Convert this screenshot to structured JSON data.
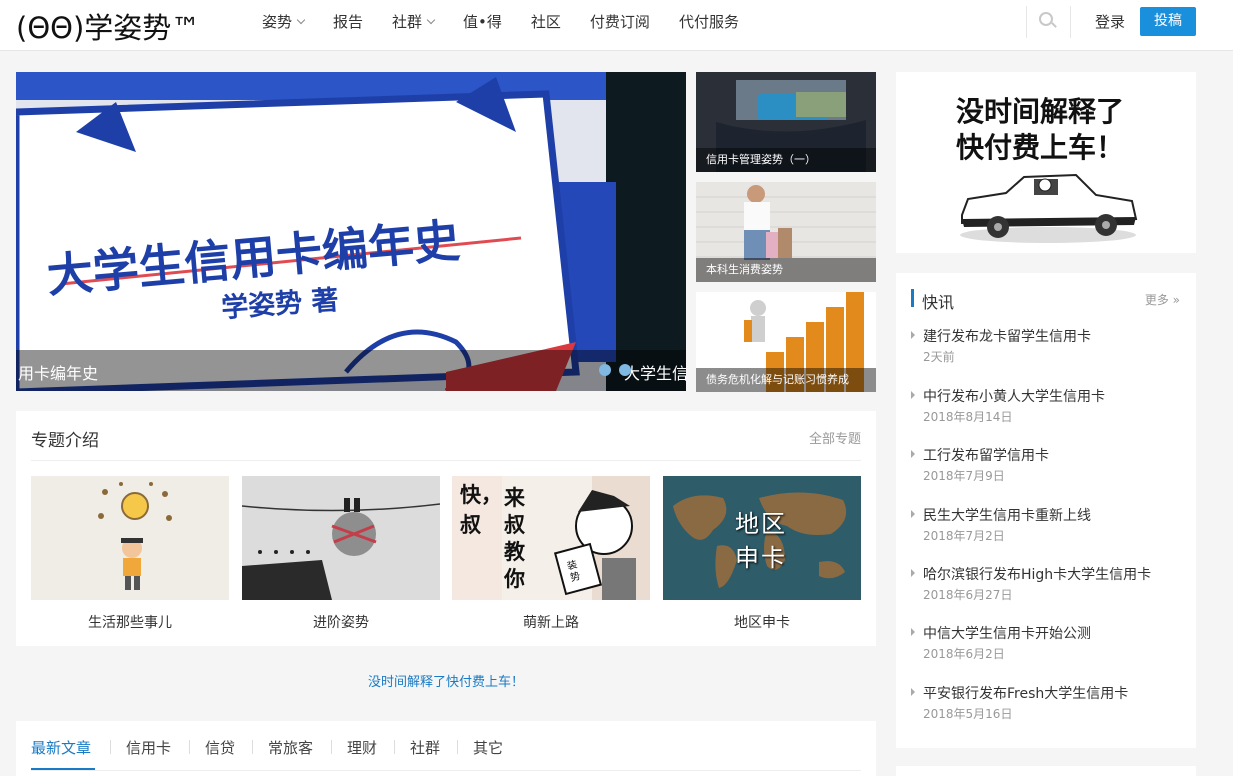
{
  "header": {
    "logo": "(ΘΘ)学姿势™",
    "nav": [
      {
        "label": "姿势",
        "dropdown": true
      },
      {
        "label": "报告",
        "dropdown": false
      },
      {
        "label": "社群",
        "dropdown": true
      },
      {
        "label": "值•得",
        "dropdown": false
      },
      {
        "label": "社区",
        "dropdown": false
      },
      {
        "label": "付费订阅",
        "dropdown": false
      },
      {
        "label": "代付服务",
        "dropdown": false
      }
    ],
    "login": "登录",
    "post_button": "投稿"
  },
  "slider": {
    "banner_title": "大学生信用卡编年史",
    "banner_author": "学姿势 著",
    "caption_current": "用卡编年史",
    "caption_next": "大学生信"
  },
  "side_thumbs": [
    {
      "caption": "信用卡管理姿势（一）"
    },
    {
      "caption": "本科生消费姿势"
    },
    {
      "caption": "债务危机化解与记账习惯养成"
    }
  ],
  "ad": {
    "line1": "没时间解释了",
    "line2": "快付费上车！"
  },
  "topics": {
    "title": "专题介绍",
    "more": "全部专题",
    "items": [
      {
        "label": "生活那些事儿"
      },
      {
        "label": "进阶姿势"
      },
      {
        "label": "萌新上路",
        "image_text": [
          "快",
          "叔",
          "来",
          "叔",
          "教",
          "你"
        ],
        "badge": "装势"
      },
      {
        "label": "地区申卡",
        "image_text": [
          "地区",
          "申卡"
        ]
      }
    ]
  },
  "promo_link": "没时间解释了快付费上车！",
  "tabs": [
    "最新文章",
    "信用卡",
    "信贷",
    "常旅客",
    "理财",
    "社群",
    "其它"
  ],
  "news": {
    "title": "快讯",
    "more": "更多 »",
    "items": [
      {
        "text": "建行发布龙卡留学生信用卡",
        "date": "2天前"
      },
      {
        "text": "中行发布小黄人大学生信用卡",
        "date": "2018年8月14日"
      },
      {
        "text": "工行发布留学信用卡",
        "date": "2018年7月9日"
      },
      {
        "text": "民生大学生信用卡重新上线",
        "date": "2018年7月2日"
      },
      {
        "text": "哈尔滨银行发布High卡大学生信用卡",
        "date": "2018年6月27日"
      },
      {
        "text": "中信大学生信用卡开始公测",
        "date": "2018年6月2日"
      },
      {
        "text": "平安银行发布Fresh大学生信用卡",
        "date": "2018年5月16日"
      }
    ]
  },
  "colors": {
    "accent": "#1a7bc5",
    "button": "#1a8fdc",
    "banner_blue": "#1e3fa8"
  }
}
